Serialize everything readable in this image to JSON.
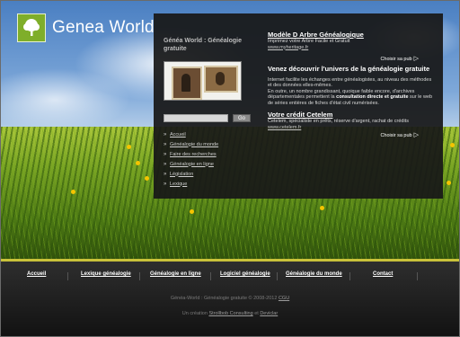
{
  "header": {
    "logo_text": "Genea World"
  },
  "sidebar": {
    "title": "Généa World : Généalogie gratuite",
    "search": {
      "value": "",
      "button": "Go"
    },
    "menu": [
      {
        "label": "Accueil"
      },
      {
        "label": "Généalogie du monde"
      },
      {
        "label": "Faire des recherches"
      },
      {
        "label": "Généalogie en ligne"
      },
      {
        "label": "Législation"
      },
      {
        "label": "Lexique"
      }
    ]
  },
  "main": {
    "ad1": {
      "title": "Modèle D Arbre Généalogique",
      "desc": "Imprimez votre Arbre Facile et Gratuit",
      "url": "www.myheritage.fr",
      "choose": "Choisir sa pub"
    },
    "headline": "Venez découvrir l'univers de la généalogie gratuite",
    "para1": "Internet facilite les échanges entre généalogistes, au niveau des méthodes et des données elles-mêmes.",
    "para2_a": "En outre, un nombre grandissant, quoique faible encore, d'archives départementales permettent la ",
    "para2_b": "consultation directe et gratuite",
    "para2_c": " sur le web de séries entières de fiches d'état civil numérisées.",
    "ad2": {
      "title": "Votre crédit Cetelem",
      "desc": "Cetelem, spécialiste en prêts, réserve d'argent, rachat de crédits",
      "url": "www.cetelem.fr",
      "choose": "Choisir sa pub"
    }
  },
  "footer": {
    "nav": [
      "Accueil",
      "Lexique généalogie",
      "Généalogie en ligne",
      "Logiciel généalogie",
      "Généalogie du monde",
      "Contact"
    ],
    "copyright": "Généa-World : Généalogie gratuite © 2008-2012 ",
    "copyright_link": "CGU",
    "credit_prefix": "Un création ",
    "credit_link1": "Strollbob Consulting",
    "credit_and": " et ",
    "credit_link2": "Deviclar"
  }
}
